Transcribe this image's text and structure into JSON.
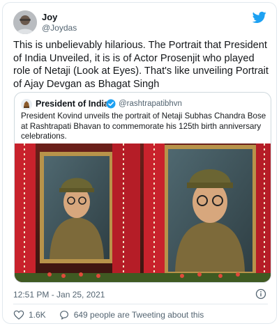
{
  "tweet": {
    "author_name": "Joy",
    "author_handle": "@Joydas",
    "text": "This is unbelievably hilarious. The Portrait that President of India Unveiled, it is is of Actor Prosenjit who played role of Netaji (Look at Eyes). That's like unveiling Portrait of Ajay Devgan as Bhagat Singh",
    "timestamp": "12:51 PM - Jan 25, 2021",
    "like_count": "1.6K",
    "tweeting_text": "649 people are Tweeting about this"
  },
  "quoted": {
    "author_name": "President of India",
    "author_handle": "@rashtrapatibhvn",
    "text": "President Kovind unveils the portrait of Netaji Subhas Chandra Bose at Rashtrapati Bhavan to commemorate his 125th birth anniversary celebrations."
  },
  "icons": {
    "brand": "twitter-bird-icon",
    "verified": "verified-badge-icon",
    "info": "info-icon",
    "like": "heart-icon",
    "reply": "speech-bubble-icon"
  },
  "colors": {
    "twitter_blue": "#1da1f2",
    "secondary_text": "#536471",
    "border": "#cfd9de"
  }
}
